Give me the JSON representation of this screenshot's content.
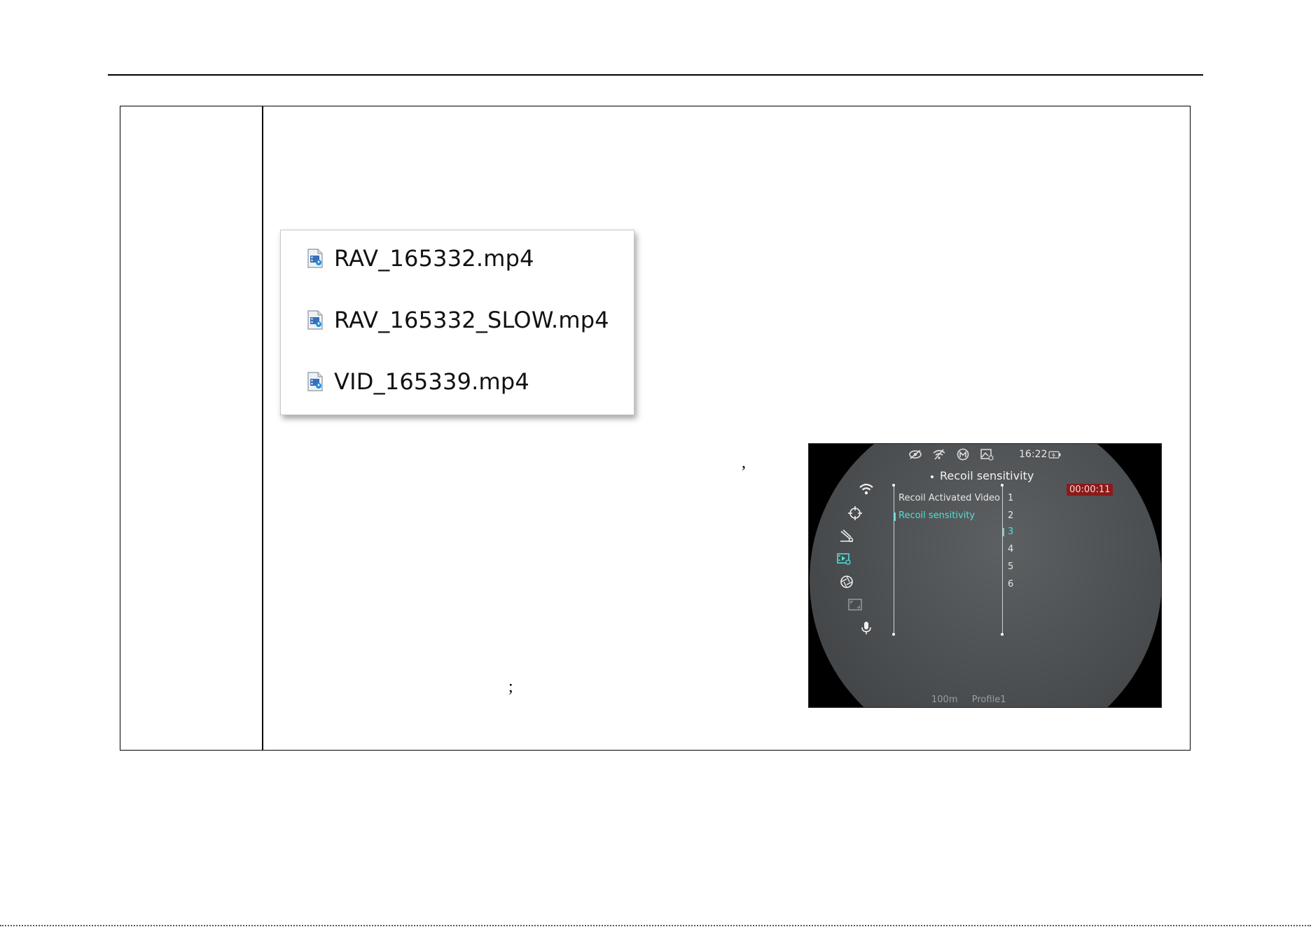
{
  "files": [
    {
      "name": "RAV_165332.mp4",
      "icon": "video-file-icon"
    },
    {
      "name": "RAV_165332_SLOW.mp4",
      "icon": "video-file-icon"
    },
    {
      "name": "VID_165339.mp4",
      "icon": "video-file-icon"
    }
  ],
  "punctuation": {
    "comma": ",",
    "semicolon": ";"
  },
  "device": {
    "status": {
      "time": "16:22"
    },
    "title": "Recoil sensitivity",
    "timer": "00:00:11",
    "menu_items": [
      "Recoil Activated Video",
      "Recoil sensitivity"
    ],
    "options": [
      "1",
      "2",
      "3",
      "4",
      "5",
      "6"
    ],
    "selected_option": "3",
    "footer": {
      "distance": "100m",
      "profile": "Profile1"
    },
    "accent_color": "#4ee0d6",
    "timer_color": "#8b1a1a"
  }
}
